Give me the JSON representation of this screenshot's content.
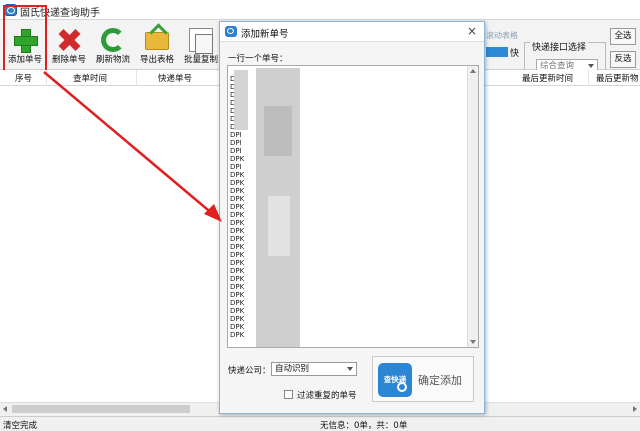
{
  "window": {
    "title": "固氏快递查询助手"
  },
  "toolbar": {
    "buttons": [
      {
        "label": "添加单号",
        "icon": "add-icon"
      },
      {
        "label": "删除单号",
        "icon": "delete-icon"
      },
      {
        "label": "刷新物流",
        "icon": "refresh-icon"
      },
      {
        "label": "导出表格",
        "icon": "export-icon"
      },
      {
        "label": "批量复制",
        "icon": "copy-icon"
      }
    ],
    "scroll_label": "滚动表格",
    "fast_label": "快",
    "api_group_title": "快递接口选择",
    "api_selected": "综合查询",
    "select_all": "全选",
    "invert_select": "反选"
  },
  "table": {
    "columns": [
      "序号",
      "查单时间",
      "快递单号",
      "最后更新时间",
      "最后更新物"
    ]
  },
  "dialog": {
    "title": "添加新单号",
    "close": "×",
    "hint": "一行一个单号：",
    "lines": [
      "D",
      "DI",
      "DI",
      "DI",
      "DPI",
      "DPI",
      "DPI",
      "DPI",
      "DPI",
      "DPI",
      "DPK",
      "DPI",
      "DPK",
      "DPK",
      "DPK",
      "DPK",
      "DPK",
      "DPK",
      "DPK",
      "DPK",
      "DPK",
      "DPK",
      "DPK",
      "DPK",
      "DPK",
      "DPK",
      "DPK",
      "DPK",
      "DPK",
      "DPK",
      "DPK",
      "DPK",
      "DPK"
    ],
    "company_label": "快递公司：",
    "company_selected": "自动识别",
    "filter_label": "过滤重复的单号",
    "confirm_icon_text": "查快递",
    "confirm_label": "确定添加"
  },
  "status": {
    "left": "清空完成",
    "center": "无信息：0单，共：0单"
  },
  "colors": {
    "accent": "#2b86d6",
    "annotation": "#e02020"
  }
}
